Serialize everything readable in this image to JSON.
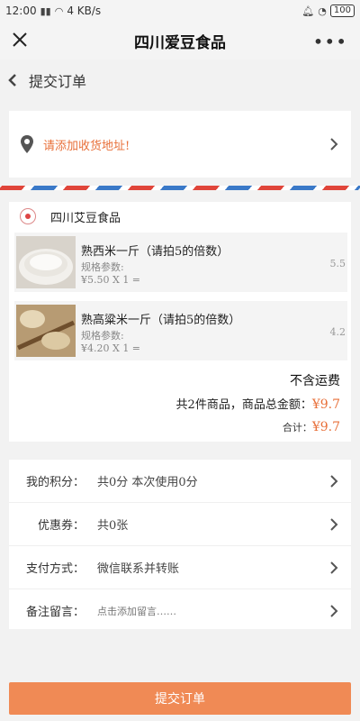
{
  "status": {
    "time": "12:00",
    "speed": "4 KB/s",
    "battery": "100"
  },
  "appbar": {
    "title": "四川爱豆食品",
    "close_icon": "close-icon",
    "more_icon": "more-dots-icon"
  },
  "page": {
    "subtitle": "提交订单",
    "back_icon": "back-chevron-icon"
  },
  "address": {
    "text": "请添加收货地址!",
    "icon": "location-pin-icon",
    "accent": "#e8703a"
  },
  "shop": {
    "name": "四川艾豆食品",
    "items": [
      {
        "name": "熟西米一斤（请拍5的倍数）",
        "spec": "规格参数:",
        "price_line": "¥5.50 X 1 =",
        "value": "5.5"
      },
      {
        "name": "熟高粱米一斤（请拍5的倍数）",
        "spec": "规格参数:",
        "price_line": "¥4.20 X 1 =",
        "value": "4.2"
      }
    ],
    "shipping": "不含运费",
    "total_label": "共2件商品，商品总金额：",
    "total_amount": "¥9.7",
    "sum_label": "合计：",
    "sum_amount": "¥9.7"
  },
  "options": [
    {
      "label": "我的积分：",
      "value": "共0分  本次使用0分"
    },
    {
      "label": "优惠券：",
      "value": "共0张"
    },
    {
      "label": "支付方式：",
      "value": "微信联系并转账"
    },
    {
      "label": "备注留言：",
      "value": "点击添加留言……"
    }
  ],
  "submit_label": "提交订单",
  "colors": {
    "accent": "#e8703a",
    "submit_bg": "#f08a55"
  }
}
